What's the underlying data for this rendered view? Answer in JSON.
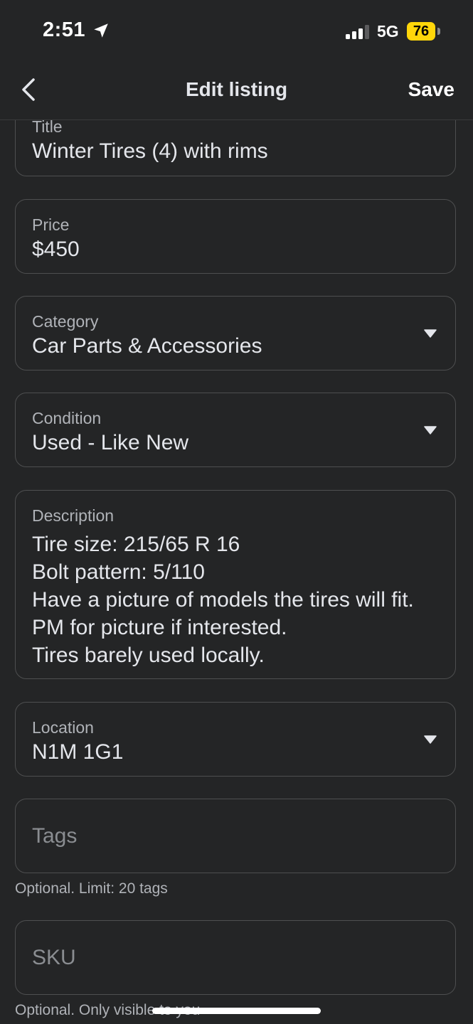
{
  "status_bar": {
    "time": "2:51",
    "network": "5G",
    "battery": "76"
  },
  "header": {
    "title": "Edit listing",
    "save_label": "Save"
  },
  "form": {
    "title": {
      "label": "Title",
      "value": "Winter Tires (4) with rims"
    },
    "price": {
      "label": "Price",
      "value": "$450"
    },
    "category": {
      "label": "Category",
      "value": "Car Parts & Accessories"
    },
    "condition": {
      "label": "Condition",
      "value": "Used - Like New"
    },
    "description": {
      "label": "Description",
      "lines": [
        "Tire size: 215/65 R 16",
        "Bolt pattern: 5/110",
        "Have a picture of models the tires will fit. PM for picture if interested.",
        "Tires barely used locally."
      ]
    },
    "location": {
      "label": "Location",
      "value": "N1M 1G1"
    },
    "tags": {
      "placeholder": "Tags",
      "helper": "Optional. Limit: 20 tags"
    },
    "sku": {
      "placeholder": "SKU",
      "helper": "Optional. Only visible to you"
    }
  },
  "colors": {
    "background": "#242526",
    "field_border": "#4e4f50",
    "battery": "#ffd60a"
  }
}
